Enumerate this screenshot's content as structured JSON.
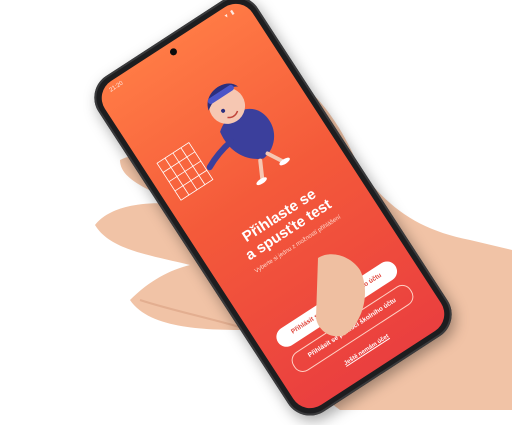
{
  "status_bar": {
    "time": "21:20",
    "icons": "▾ ▮"
  },
  "screen": {
    "title_line1": "Přihlaste se",
    "title_line2": "a spusťte test",
    "subtitle": "Vyberte si jednu z možností přihlášení",
    "primary_button": "Přihlásit se pomocí osobního účtu",
    "secondary_button": "Přihlásit se pomocí školního účtu",
    "link": "Ještě nemám účet"
  },
  "colors": {
    "screen_top": "#ff7a45",
    "screen_bottom": "#ea3f3f",
    "accent": "#e0453b"
  },
  "icons": [
    "camera-icon",
    "mascot-illustration",
    "grid-board-illustration"
  ]
}
